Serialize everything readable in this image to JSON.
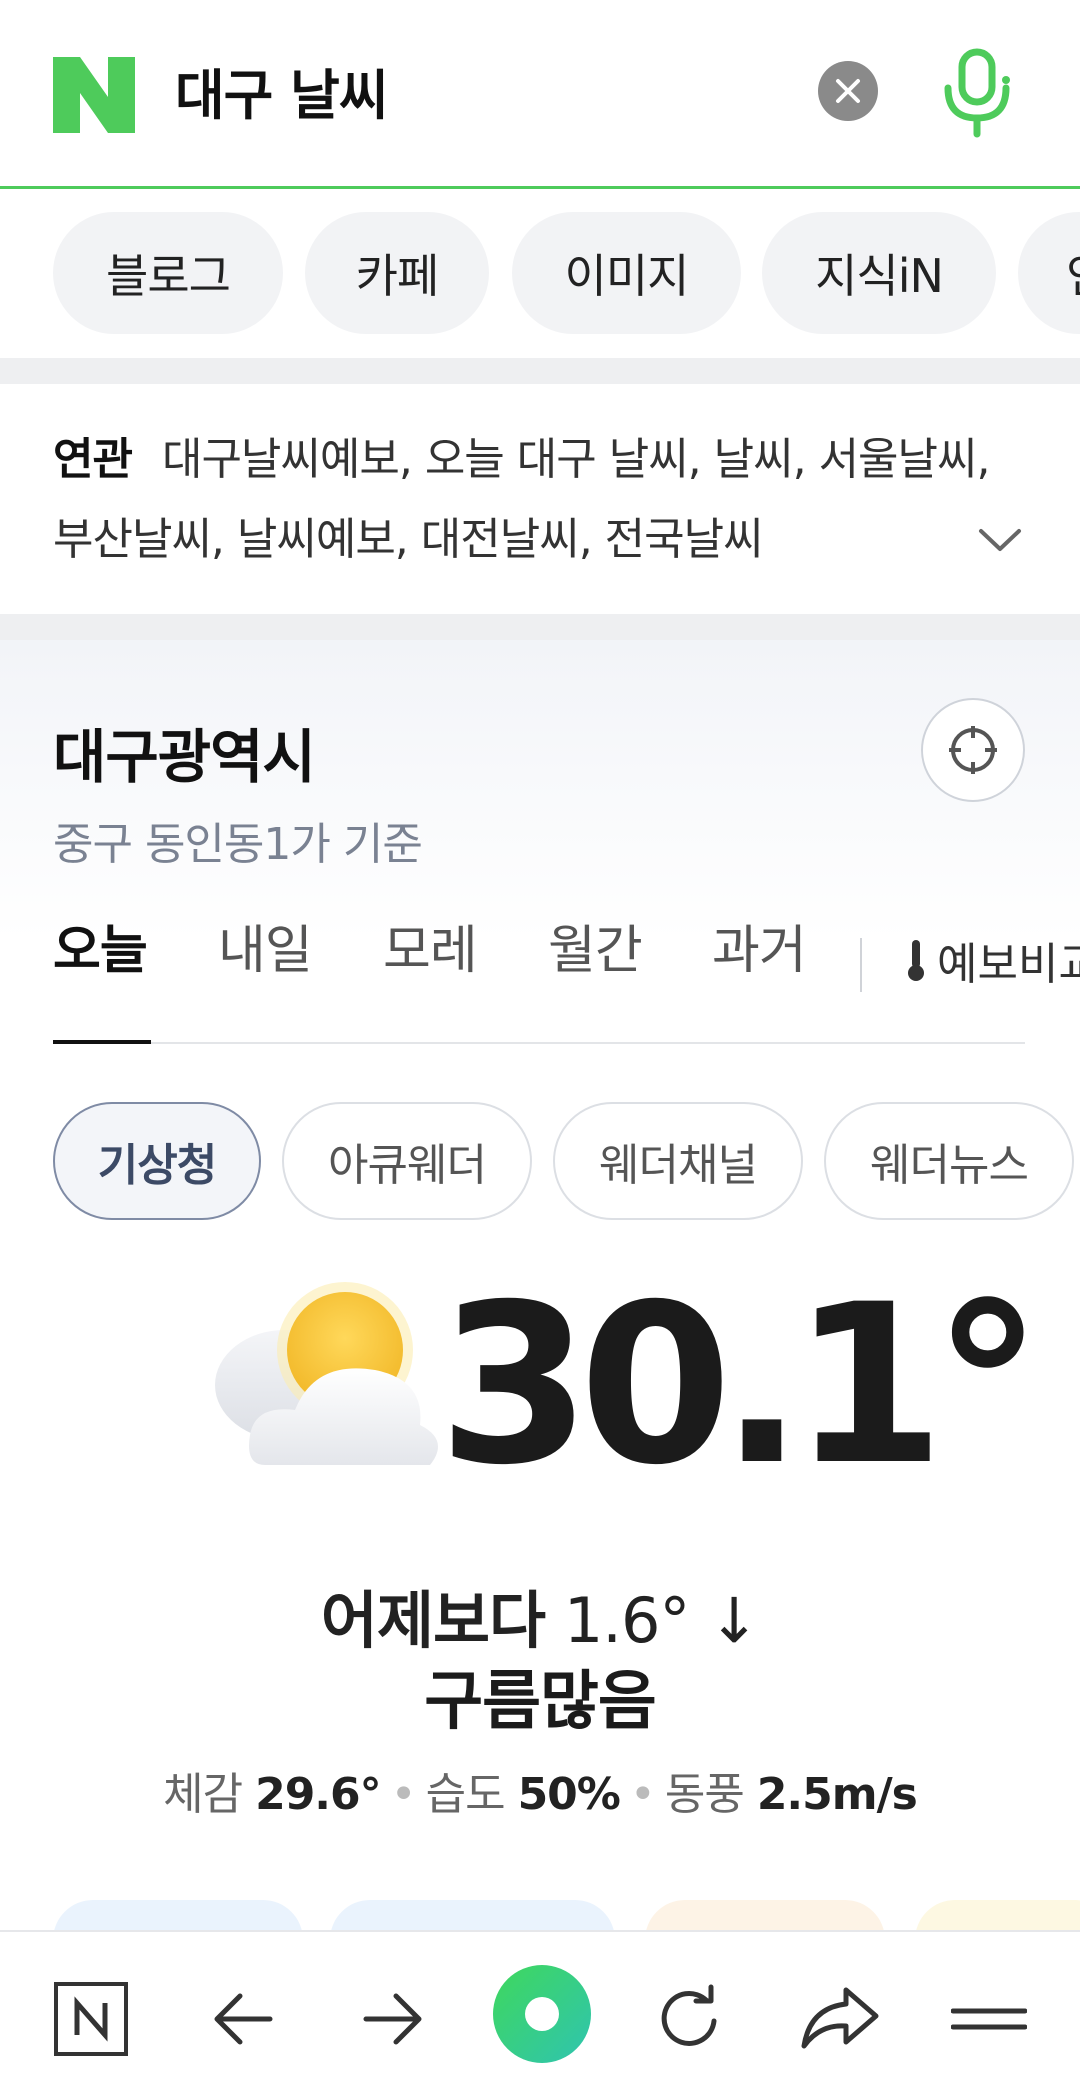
{
  "search": {
    "query": "대구 날씨",
    "clear_icon": "close-icon",
    "voice_icon": "mic-icon",
    "accent": "#4ecb5b"
  },
  "tabs": [
    {
      "label": "블로그"
    },
    {
      "label": "카페"
    },
    {
      "label": "이미지"
    },
    {
      "label": "지식iN"
    },
    {
      "label": "인"
    }
  ],
  "related": {
    "label": "연관",
    "keywords": "대구날씨예보, 오늘 대구 날씨, 날씨, 서울날씨, 부산날씨, 날씨예보, 대전날씨, 전국날씨"
  },
  "weather": {
    "location": "대구광역시",
    "sublocation": "중구 동인동1가 기준",
    "day_tabs": [
      "오늘",
      "내일",
      "모레",
      "월간",
      "과거"
    ],
    "compare_label": "예보비교",
    "providers": [
      "기상청",
      "아큐웨더",
      "웨더채널",
      "웨더뉴스"
    ],
    "icon": "partly-cloudy-icon",
    "temperature": "30.1°",
    "compare_prefix": "어제보다",
    "compare_value": "1.6° ↓",
    "condition": "구름많음",
    "feels_label": "체감",
    "feels_value": "29.6°",
    "humidity_label": "습도",
    "humidity_value": "50%",
    "wind_label": "동풍",
    "wind_value": "2.5m/s"
  },
  "toolbar": {
    "icons": [
      "naver-home-icon",
      "back-arrow-icon",
      "forward-arrow-icon",
      "green-dot-icon",
      "refresh-icon",
      "share-icon",
      "menu-icon"
    ]
  }
}
